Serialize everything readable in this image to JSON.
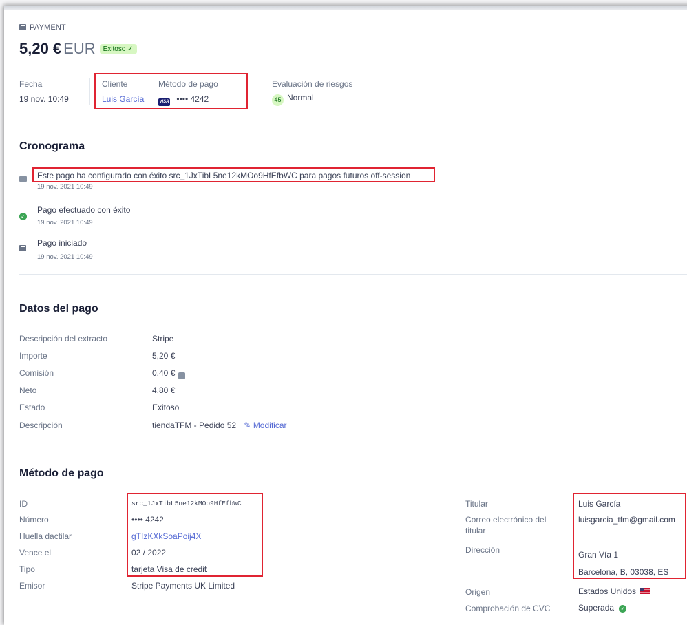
{
  "header": {
    "kicker": "PAYMENT",
    "amount": "5,20 €",
    "currency": "EUR",
    "status_badge": "Exitoso ✓"
  },
  "summary": {
    "date_label": "Fecha",
    "date_value": "19 nov. 10:49",
    "customer_label": "Cliente",
    "customer_value": "Luis García",
    "method_label": "Método de pago",
    "method_brand": "VISA",
    "method_value": "•••• 4242",
    "risk_label": "Evaluación de riesgos",
    "risk_score": "45",
    "risk_value": "Normal"
  },
  "timeline": {
    "title": "Cronograma",
    "events": [
      {
        "title": "Este pago ha configurado con éxito src_1JxTibL5ne12kMOo9HfEfbWC para pagos futuros off-session",
        "date": "19 nov. 2021 10:49",
        "icon": "card-icon"
      },
      {
        "title": "Pago efectuado con éxito",
        "date": "19 nov. 2021 10:49",
        "icon": "check-circle-icon"
      },
      {
        "title": "Pago iniciado",
        "date": "19 nov. 2021 10:49",
        "icon": "payment-icon"
      }
    ]
  },
  "payment_details": {
    "title": "Datos del pago",
    "rows": [
      {
        "label": "Descripción del extracto",
        "value": "Stripe"
      },
      {
        "label": "Importe",
        "value": "5,20 €"
      },
      {
        "label": "Comisión",
        "value": "0,40 €"
      },
      {
        "label": "Neto",
        "value": "4,80 €"
      },
      {
        "label": "Estado",
        "value": "Exitoso"
      },
      {
        "label": "Descripción",
        "value": "tiendaTFM - Pedido 52"
      }
    ],
    "edit_label": "Modificar"
  },
  "payment_method": {
    "title": "Método de pago",
    "left_rows": [
      {
        "label": "ID",
        "value": "src_1JxTibL5ne12kMOo9HfEfbWC"
      },
      {
        "label": "Número",
        "value": "•••• 4242"
      },
      {
        "label": "Huella dactilar",
        "value": "gTIzKXkSoaPoij4X"
      },
      {
        "label": "Vence el",
        "value": "02 / 2022"
      },
      {
        "label": "Tipo",
        "value": "tarjeta Visa de credit"
      },
      {
        "label": "Emisor",
        "value": "Stripe Payments UK Limited"
      }
    ],
    "right_rows": {
      "holder_label": "Titular",
      "holder_value": "Luis García",
      "email_label_1": "Correo electrónico del",
      "email_label_2": "titular",
      "email_value": "luisgarcia_tfm@gmail.com",
      "address_label": "Dirección",
      "address_line1": "Gran Vía 1",
      "address_line2": "Barcelona, B, 03038, ES",
      "origin_label": "Origen",
      "origin_value": "Estados Unidos",
      "cvc_label": "Comprobación de CVC",
      "cvc_value": "Superada"
    }
  },
  "colors": {
    "accent": "#5469d4",
    "success_bg": "#d7f7c2",
    "success_text": "#05690d",
    "highlight_border": "#e02432"
  }
}
